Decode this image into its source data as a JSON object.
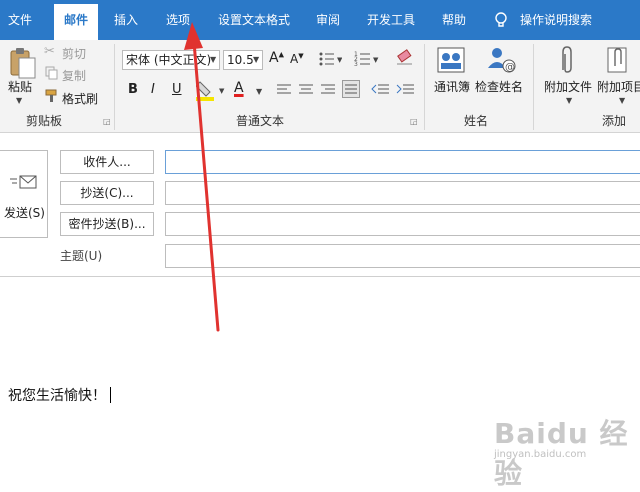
{
  "tabs": [
    {
      "label": "文件"
    },
    {
      "label": "邮件"
    },
    {
      "label": "插入"
    },
    {
      "label": "选项"
    },
    {
      "label": "设置文本格式"
    },
    {
      "label": "审阅"
    },
    {
      "label": "开发工具"
    },
    {
      "label": "帮助"
    },
    {
      "label": "操作说明搜索"
    }
  ],
  "clipboard": {
    "paste_label": "粘贴",
    "cut_label": "剪切",
    "copy_label": "复制",
    "format_painter_label": "格式刷",
    "group_label": "剪贴板"
  },
  "basic_text": {
    "font_name": "宋体 (中文正文)",
    "font_size": "10.5",
    "bold": "B",
    "italic": "I",
    "underline": "U",
    "font_color_glyph": "A",
    "group_label": "普通文本"
  },
  "names": {
    "address_book_label": "通讯簿",
    "check_names_label": "检查姓名",
    "group_label": "姓名"
  },
  "include": {
    "attach_file_label": "附加文件",
    "attach_item_label": "附加项目",
    "group_label": "添加"
  },
  "compose": {
    "send_label": "发送(S)",
    "to_button": "收件人...",
    "cc_button": "抄送(C)...",
    "bcc_button": "密件抄送(B)...",
    "subject_label": "主题(U)",
    "body_text": "祝您生活愉快！"
  },
  "watermark": {
    "brand": "Baidu 经验",
    "url": "jingyan.baidu.com"
  },
  "colors": {
    "ribbon_blue": "#2b79c8",
    "annotation_arrow": "#e0322f",
    "highlight_yellow": "#f5e500",
    "font_red": "#e02020"
  }
}
